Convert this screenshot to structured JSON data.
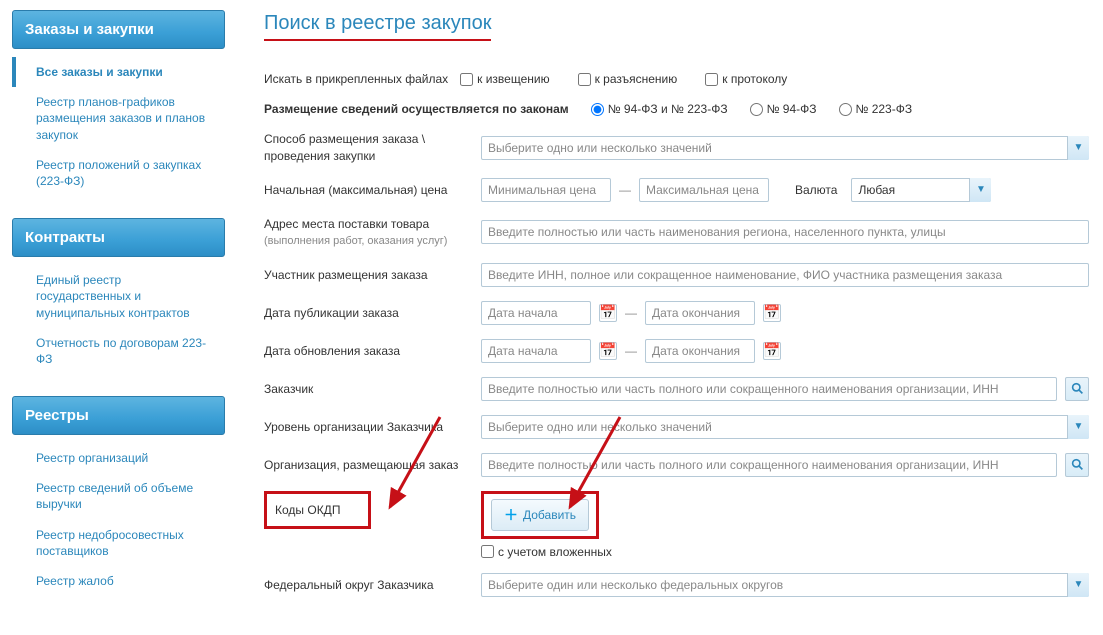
{
  "sidebar": {
    "blocks": [
      {
        "title": "Заказы и закупки",
        "items": [
          {
            "label": "Все заказы и закупки",
            "active": true
          },
          {
            "label": "Реестр планов-графиков размещения заказов и планов закупок"
          },
          {
            "label": "Реестр положений о закупках (223-ФЗ)"
          }
        ]
      },
      {
        "title": "Контракты",
        "items": [
          {
            "label": "Единый реестр государственных и муниципальных контрактов"
          },
          {
            "label": "Отчетность по договорам 223-ФЗ"
          }
        ]
      },
      {
        "title": "Реестры",
        "items": [
          {
            "label": "Реестр организаций"
          },
          {
            "label": "Реестр сведений об объеме выручки"
          },
          {
            "label": "Реестр недобросовестных поставщиков"
          },
          {
            "label": "Реестр жалоб"
          }
        ]
      }
    ]
  },
  "page": {
    "title": "Поиск в реестре закупок"
  },
  "search_attach": {
    "label": "Искать в прикрепленных файлах",
    "opt1": "к извещению",
    "opt2": "к разъяснению",
    "opt3": "к протоколу"
  },
  "laws": {
    "label": "Размещение сведений осуществляется по законам",
    "opt1": "№ 94-ФЗ и № 223-ФЗ",
    "opt2": "№ 94-ФЗ",
    "opt3": "№ 223-ФЗ"
  },
  "method": {
    "label": "Способ размещения заказа \\ проведения закупки",
    "placeholder": "Выберите одно или несколько значений"
  },
  "price": {
    "label": "Начальная (максимальная) цена",
    "min_ph": "Минимальная цена",
    "max_ph": "Максимальная цена",
    "dash": "—",
    "currency_label": "Валюта",
    "currency_value": "Любая"
  },
  "address": {
    "label": "Адрес места поставки товара",
    "hint": "(выполнения работ, оказания услуг)",
    "placeholder": "Введите полностью или часть наименования региона, населенного пункта, улицы"
  },
  "participant": {
    "label": "Участник размещения заказа",
    "placeholder": "Введите ИНН, полное или сокращенное наименование, ФИО участника размещения заказа"
  },
  "pubdate": {
    "label": "Дата публикации заказа",
    "start_ph": "Дата начала",
    "end_ph": "Дата окончания",
    "dash": "—"
  },
  "upddate": {
    "label": "Дата обновления заказа",
    "start_ph": "Дата начала",
    "end_ph": "Дата окончания",
    "dash": "—"
  },
  "customer": {
    "label": "Заказчик",
    "placeholder": "Введите полностью или часть полного или сокращенного наименования организации, ИНН"
  },
  "level": {
    "label": "Уровень организации Заказчика",
    "placeholder": "Выберите одно или несколько значений"
  },
  "placer": {
    "label": "Организация, размещающая заказ",
    "placeholder": "Введите полностью или часть полного или сокращенного наименования организации, ИНН"
  },
  "okdp": {
    "label": "Коды ОКДП",
    "add_btn": "Добавить",
    "nested": "с учетом вложенных"
  },
  "district": {
    "label": "Федеральный округ Заказчика",
    "placeholder": "Выберите один или несколько федеральных округов"
  }
}
